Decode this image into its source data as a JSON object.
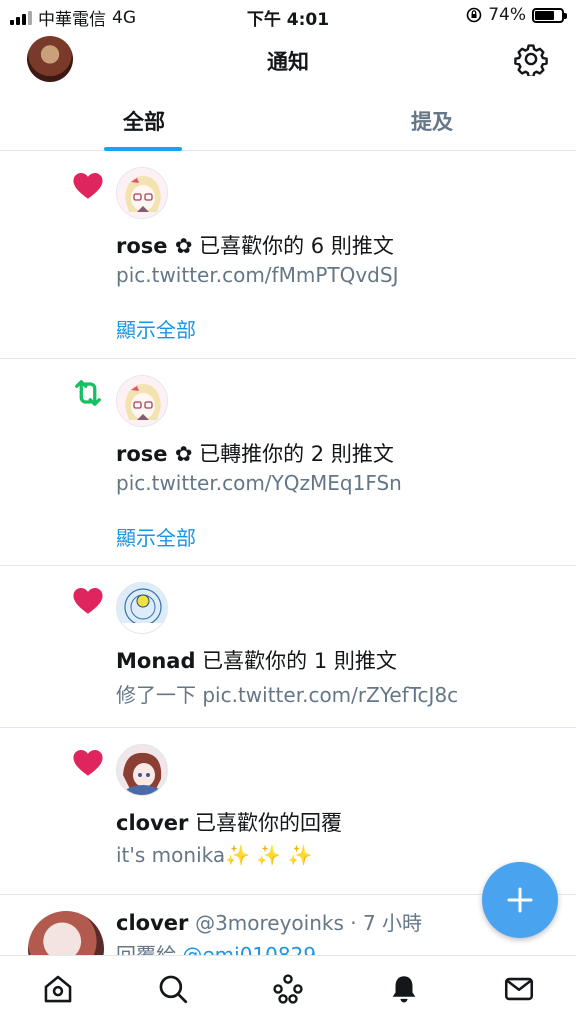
{
  "status_bar": {
    "carrier": "中華電信",
    "network": "4G",
    "time": "下午 4:01",
    "battery": "74%",
    "battery_level": 0.74
  },
  "header": {
    "title": "通知"
  },
  "tabs": [
    {
      "label": "全部",
      "active": true
    },
    {
      "label": "提及",
      "active": false
    }
  ],
  "notifications": [
    {
      "type": "like",
      "icon": "heart-icon",
      "user": "rose ✿",
      "action": " 已喜歡你的 6 則推文",
      "sub": "pic.twitter.com/fMmPTQvdSJ",
      "link": "顯示全部"
    },
    {
      "type": "retweet",
      "icon": "retweet-icon",
      "user": "rose ✿",
      "action": " 已轉推你的 2 則推文",
      "sub": "pic.twitter.com/YQzMEq1FSn",
      "link": "顯示全部"
    },
    {
      "type": "like",
      "icon": "heart-icon",
      "user": "Monad",
      "action": " 已喜歡你的 1 則推文",
      "sub": "修了一下 pic.twitter.com/rZYefTcJ8c"
    },
    {
      "type": "like",
      "icon": "heart-icon",
      "user": "clover",
      "action": " 已喜歡你的回覆",
      "sub": "it's monika✨ ✨ ✨"
    }
  ],
  "tweet": {
    "name": "clover",
    "handle": "@3moreyoinks",
    "time": " · 7 小時",
    "reply_prefix": "回覆給 ",
    "reply_handle": "@emi010829"
  },
  "colors": {
    "accent": "#1da1f2",
    "like": "#e0245e",
    "retweet": "#17bf63",
    "fab": "#4aa3ee"
  }
}
